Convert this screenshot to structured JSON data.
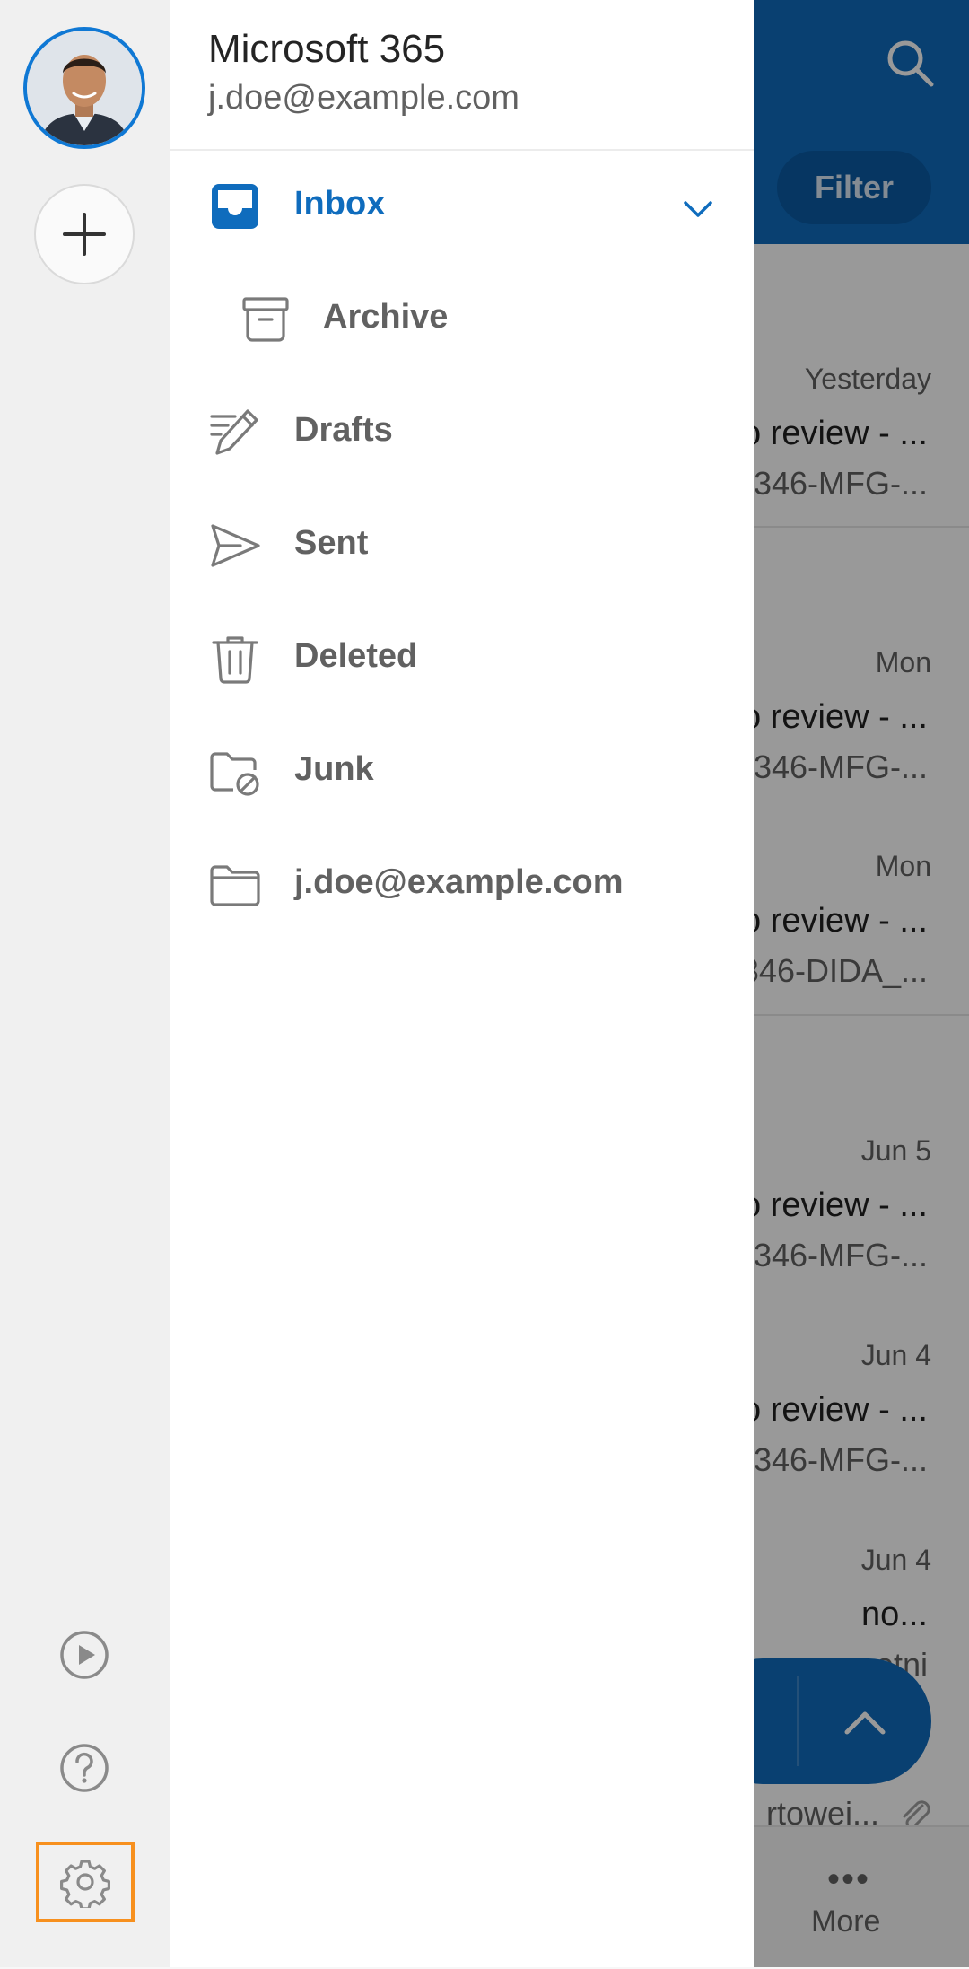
{
  "background": {
    "filter_label": "Filter",
    "items": [
      {
        "date": "Yesterday",
        "subject": "o review - ...",
        "preview": "346-MFG-..."
      },
      {
        "date": "Mon",
        "subject": "o review - ...",
        "preview": "346-MFG-..."
      },
      {
        "date": "Mon",
        "subject": "o review - ...",
        "preview": "346-DIDA_..."
      },
      {
        "date": "Jun 5",
        "subject": "o review - ...",
        "preview": "346-MFG-..."
      },
      {
        "date": "Jun 4",
        "subject": "o review - ...",
        "preview": "346-MFG-..."
      },
      {
        "date": "Jun 4",
        "subject": "no...",
        "preview": "etni"
      }
    ],
    "last_item_preview": "rtowei...",
    "more_label": "More",
    "more_dots": "•••"
  },
  "account": {
    "name": "Microsoft 365",
    "email": "j.doe@example.com"
  },
  "folders": [
    {
      "id": "inbox",
      "label": "Inbox",
      "icon": "inbox-icon",
      "active": true
    },
    {
      "id": "archive",
      "label": "Archive",
      "icon": "archive-icon",
      "sub": true
    },
    {
      "id": "drafts",
      "label": "Drafts",
      "icon": "drafts-icon"
    },
    {
      "id": "sent",
      "label": "Sent",
      "icon": "sent-icon"
    },
    {
      "id": "deleted",
      "label": "Deleted",
      "icon": "trash-icon"
    },
    {
      "id": "junk",
      "label": "Junk",
      "icon": "junk-folder-icon"
    },
    {
      "id": "account-folder",
      "label": "j.doe@example.com",
      "icon": "folder-icon"
    }
  ],
  "rail": {
    "icons": [
      "avatar",
      "add-icon",
      "play-icon",
      "help-icon",
      "settings-icon"
    ]
  },
  "colors": {
    "accent": "#0f6cbd",
    "highlight_frame": "#f7901e",
    "rail_bg": "#f0f0f0"
  }
}
